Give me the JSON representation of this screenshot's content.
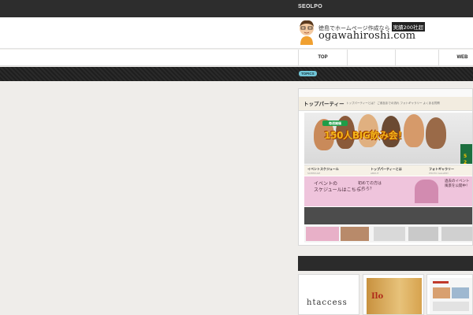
{
  "topbar": {
    "brand": "SEOLPO"
  },
  "header": {
    "tagline": "徳島でホームページ作成なら",
    "badge": "実績200社超",
    "site_name": "ogawahiroshi.com"
  },
  "nav": {
    "items": [
      "TOP",
      "",
      "",
      "WEB"
    ]
  },
  "band": {
    "topics_label": "TOPICS"
  },
  "screenshot": {
    "logo": "トップパーティー",
    "links": "トップパーティーとは？    ご参加までの流れ    フォトギャラリー    よくある質問",
    "banner": "150人BIG飲み会！",
    "chip": "毎週開催",
    "side": [
      "5",
      "2"
    ],
    "columns": [
      {
        "title": "イベントスケジュール",
        "sub": "SCHEDULE"
      },
      {
        "title": "トップパーティーとは",
        "sub": "ABOUT"
      },
      {
        "title": "フォトギャラリー",
        "sub": "PHOTO GALLERY"
      }
    ],
    "pink_left": [
      "イベントの",
      "スケジュールはこちら！"
    ],
    "pink_mid": [
      "初めての方は",
      "こちら？"
    ],
    "pink_right": [
      "過去のイベント",
      "風景を公開中！"
    ]
  },
  "cards": {
    "card1_text": "htaccess",
    "card2_text": "Ilo"
  },
  "colors": {
    "topbar": "#2d2d2d",
    "topics": "#71c6d8",
    "background": "#efedea"
  }
}
